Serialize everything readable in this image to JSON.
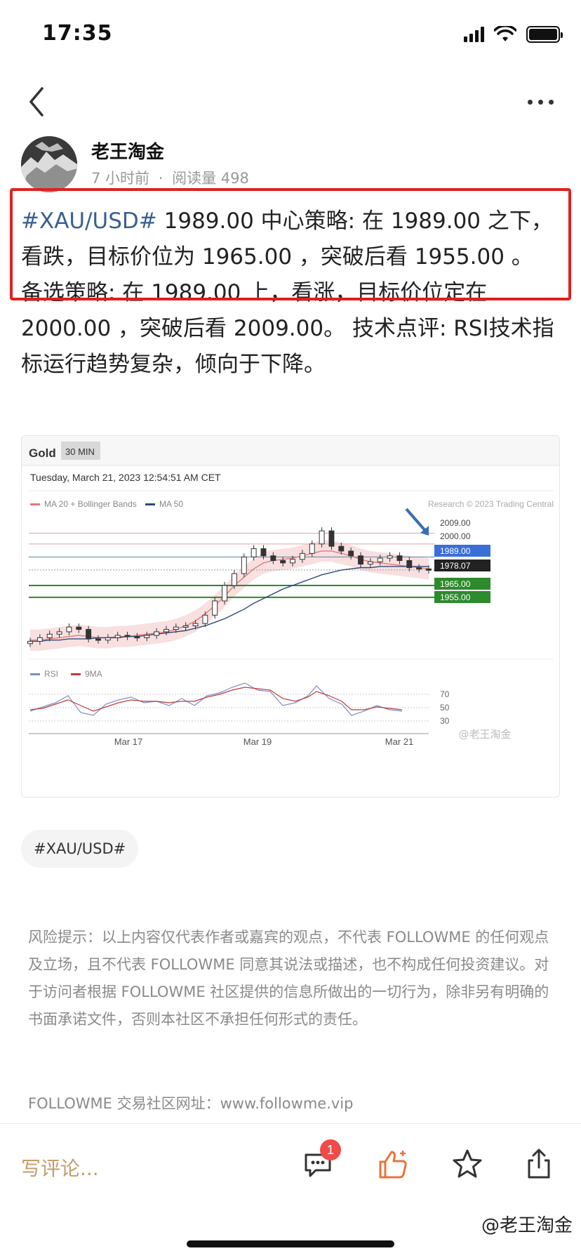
{
  "status_bar": {
    "time": "17:35"
  },
  "author": {
    "name": "老王淘金",
    "time": "7 小时前",
    "meta_sep": "·",
    "reads": "阅读量 498"
  },
  "article": {
    "hashtag": "#XAU/USD#",
    "body": " 1989.00 中心策略: 在 1989.00 之下，看跌，目标价位为 1965.00 ，突破后看 1955.00 。 备选策略: 在 1989.00 上，看涨，目标价位定在 2000.00 ，突破后看 2009.00。 技术点评: RSI技术指标运行趋势复杂，倾向于下降。"
  },
  "chart": {
    "symbol": "Gold",
    "timeframe": "30 MIN",
    "datetime": "Tuesday, March 21, 2023 12:54:51 AM CET",
    "legend_bb": "MA 20 + Bollinger Bands",
    "legend_ma": "MA 50",
    "copyright": "Research © 2023 Trading Central",
    "legend_rsi": "RSI",
    "legend_9ma": "9MA",
    "watermark": "@老王淘金",
    "colors": {
      "bb": "#e07a7a",
      "ma50": "#2b4a7a",
      "blue_label": "#3a6fd8",
      "black_label": "#222222",
      "green_label": "#2d8a2d",
      "red_line": "#e8a0a0"
    },
    "price_labels": [
      {
        "value": "2009.00",
        "style": "plain"
      },
      {
        "value": "2000.00",
        "style": "plain"
      },
      {
        "value": "1989.00",
        "style": "blue"
      },
      {
        "value": "1978.07",
        "style": "black"
      },
      {
        "value": "1965.00",
        "style": "green"
      },
      {
        "value": "1955.00",
        "style": "green"
      }
    ],
    "rsi_levels": [
      "70",
      "50",
      "30"
    ],
    "x_ticks": [
      "Mar 17",
      "Mar 19",
      "Mar 21"
    ]
  },
  "chart_data": {
    "type": "line",
    "title": "Gold",
    "xlabel": "",
    "ylabel": "",
    "x_ticks": [
      "Mar 17",
      "Mar 19",
      "Mar 21"
    ],
    "horizontal_levels": [
      2009.0,
      2000.0,
      1989.0,
      1978.07,
      1965.0,
      1955.0
    ],
    "ylim": [
      1910,
      2020
    ],
    "series": [
      {
        "name": "MA 20 + Bollinger Bands",
        "values": [
          1919,
          1919,
          1920,
          1921,
          1922,
          1923,
          1922,
          1921,
          1921,
          1922,
          1922,
          1923,
          1924,
          1925,
          1926,
          1928,
          1931,
          1935,
          1941,
          1948,
          1956,
          1965,
          1972,
          1979,
          1984,
          1986,
          1987,
          1988,
          1990,
          1992,
          1994,
          1994,
          1992,
          1990,
          1987,
          1985,
          1984,
          1983,
          1982,
          1981,
          1980,
          1979
        ]
      },
      {
        "name": "MA 50",
        "values": [
          1918,
          1918,
          1919,
          1919,
          1920,
          1920,
          1920,
          1921,
          1921,
          1921,
          1922,
          1922,
          1923,
          1924,
          1925,
          1926,
          1927,
          1929,
          1931,
          1934,
          1937,
          1941,
          1945,
          1950,
          1954,
          1958,
          1962,
          1965,
          1968,
          1971,
          1974,
          1976,
          1978,
          1979,
          1980,
          1980,
          1981,
          1981,
          1981,
          1981,
          1981,
          1981
        ]
      }
    ],
    "close": [
      1918,
      1921,
      1924,
      1926,
      1930,
      1928,
      1920,
      1919,
      1921,
      1923,
      1922,
      1921,
      1923,
      1926,
      1928,
      1930,
      1931,
      1933,
      1940,
      1952,
      1965,
      1975,
      1989,
      1996,
      1990,
      1986,
      1984,
      1987,
      1992,
      2000,
      2011,
      1998,
      1994,
      1990,
      1983,
      1985,
      1988,
      1990,
      1986,
      1980,
      1979,
      1978.07
    ]
  },
  "tag": "#XAU/USD#",
  "disclaimer": "风险提示：以上内容仅代表作者或嘉宾的观点，不代表 FOLLOWME 的任何观点及立场，且不代表 FOLLOWME 同意其说法或描述，也不构成任何投资建议。对于访问者根据 FOLLOWME 社区提供的信息所做出的一切行为，除非另有明确的书面承诺文件，否则本社区不承担任何形式的责任。",
  "site_line": "FOLLOWME 交易社区网址：www.followme.vip",
  "bottom": {
    "comment_placeholder": "写评论...",
    "comment_badge": "1",
    "watermark": "@老王淘金"
  }
}
